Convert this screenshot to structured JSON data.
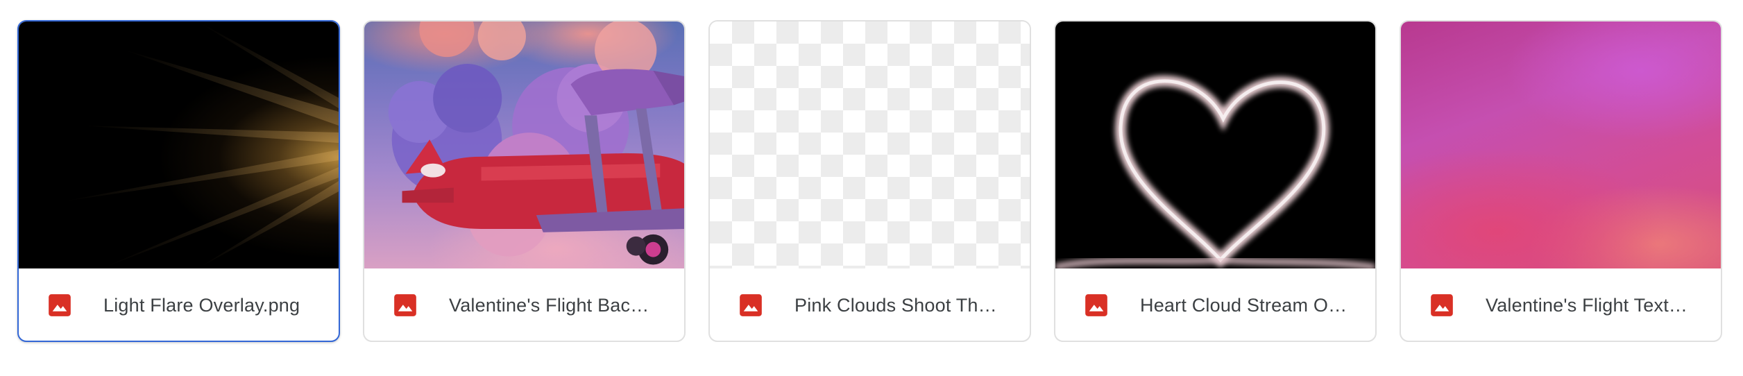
{
  "files": [
    {
      "name": "Light Flare Overlay.png",
      "type": "image",
      "thumbnail": "light-flare",
      "selected": true
    },
    {
      "name": "Valentine's Flight Back…",
      "type": "image",
      "thumbnail": "red-biplane-heart-cloud",
      "selected": false
    },
    {
      "name": "Pink Clouds Shoot Thr…",
      "type": "image",
      "thumbnail": "transparent-checkerboard",
      "selected": false
    },
    {
      "name": "Heart Cloud Stream Ov…",
      "type": "image",
      "thumbnail": "heart-cloud-on-black",
      "selected": false
    },
    {
      "name": "Valentine's Flight Text…",
      "type": "image",
      "thumbnail": "pink-purple-gradient-texture",
      "selected": false
    }
  ],
  "colors": {
    "image_icon": "#d93025",
    "selected_border": "#3367d6",
    "card_border": "#e0e0e0",
    "text": "#3c4043"
  },
  "icons": {
    "file_type": "image-file-icon"
  }
}
